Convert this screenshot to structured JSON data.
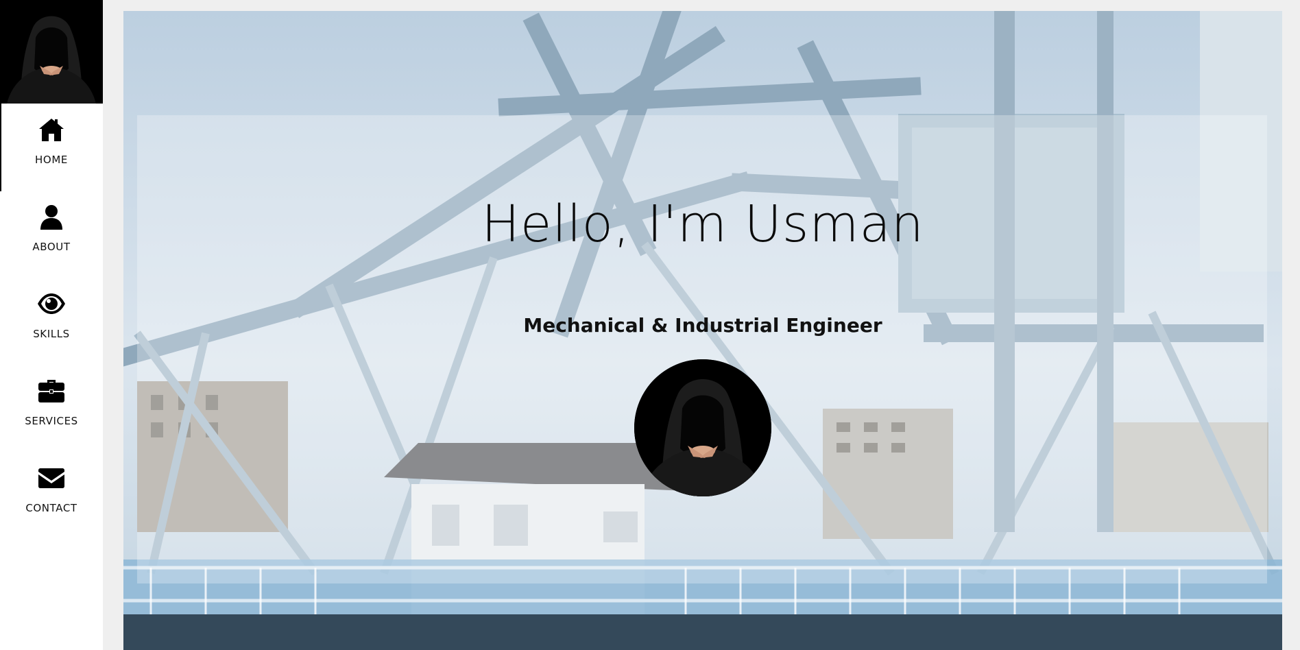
{
  "profile": {
    "avatar_icon": "hooded-figure-icon"
  },
  "nav": {
    "active": "home",
    "items": [
      {
        "label": "HOME",
        "icon": "home-icon"
      },
      {
        "label": "ABOUT",
        "icon": "user-icon"
      },
      {
        "label": "SKILLS",
        "icon": "eye-icon"
      },
      {
        "label": "SERVICES",
        "icon": "briefcase-icon"
      },
      {
        "label": "CONTACT",
        "icon": "envelope-icon"
      }
    ]
  },
  "hero": {
    "title": "Hello, I'm Usman",
    "subtitle": "Mechanical & Industrial Engineer",
    "background_image": "steel-bridge-photo",
    "avatar_icon": "hooded-figure-icon"
  },
  "colors": {
    "sidebar_bg": "#ffffff",
    "page_bg": "#efefef",
    "text": "#000000",
    "sky": "#c9d8e6",
    "steel": "#9fb6c8"
  }
}
